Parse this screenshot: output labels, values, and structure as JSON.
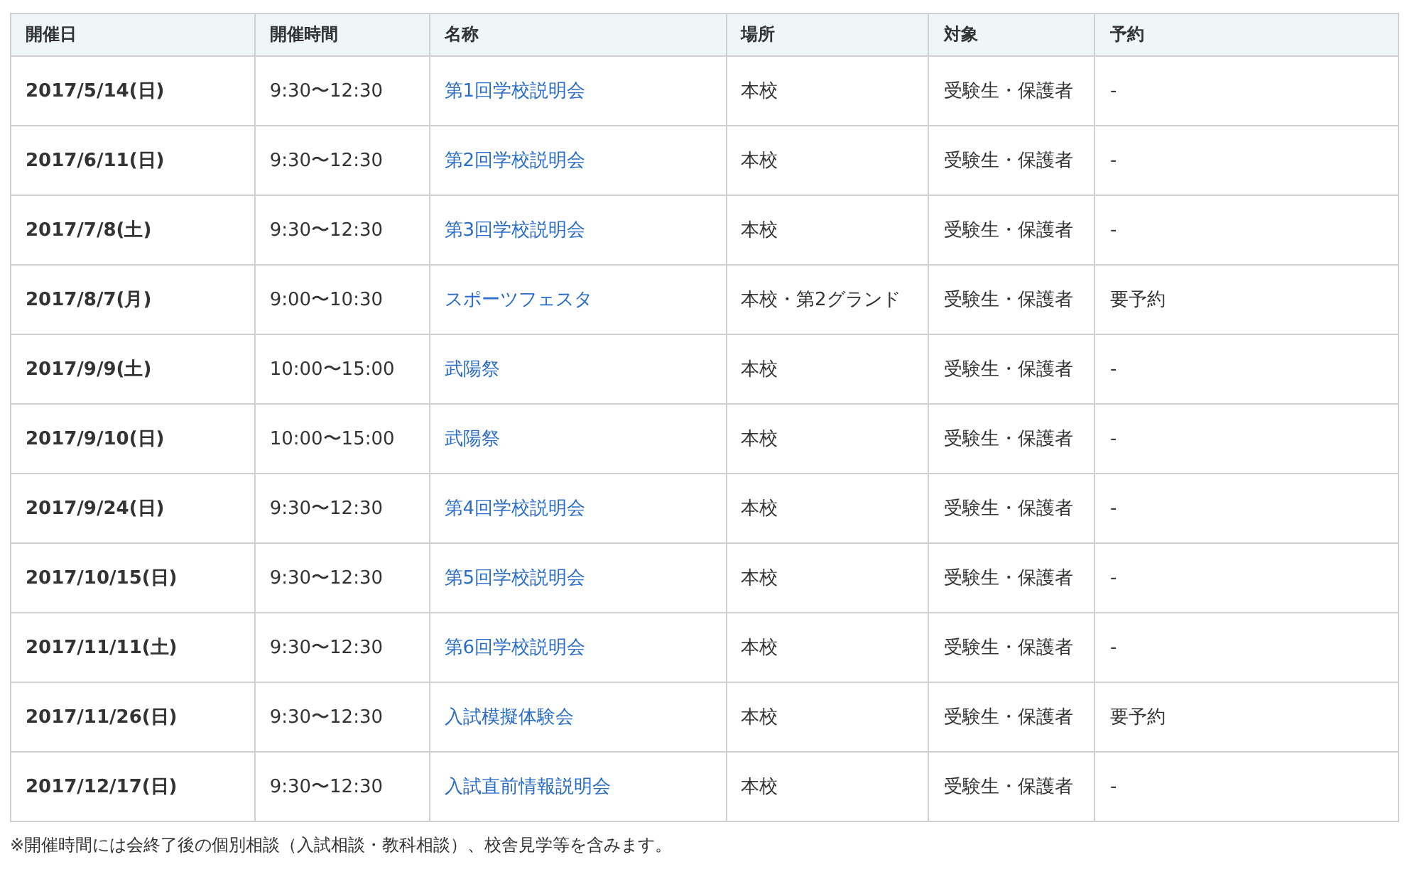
{
  "table": {
    "columns": [
      "開催日",
      "開催時間",
      "名称",
      "場所",
      "対象",
      "予約"
    ],
    "rows": [
      [
        "2017/5/14(日)",
        "9:30〜12:30",
        "第1回学校説明会",
        "本校",
        "受験生・保護者",
        "-"
      ],
      [
        "2017/6/11(日)",
        "9:30〜12:30",
        "第2回学校説明会",
        "本校",
        "受験生・保護者",
        "-"
      ],
      [
        "2017/7/8(土)",
        "9:30〜12:30",
        "第3回学校説明会",
        "本校",
        "受験生・保護者",
        "-"
      ],
      [
        "2017/8/7(月)",
        "9:00〜10:30",
        "スポーツフェスタ",
        "本校・第2グランド",
        "受験生・保護者",
        "要予約"
      ],
      [
        "2017/9/9(土)",
        "10:00〜15:00",
        "武陽祭",
        "本校",
        "受験生・保護者",
        "-"
      ],
      [
        "2017/9/10(日)",
        "10:00〜15:00",
        "武陽祭",
        "本校",
        "受験生・保護者",
        "-"
      ],
      [
        "2017/9/24(日)",
        "9:30〜12:30",
        "第4回学校説明会",
        "本校",
        "受験生・保護者",
        "-"
      ],
      [
        "2017/10/15(日)",
        "9:30〜12:30",
        "第5回学校説明会",
        "本校",
        "受験生・保護者",
        "-"
      ],
      [
        "2017/11/11(土)",
        "9:30〜12:30",
        "第6回学校説明会",
        "本校",
        "受験生・保護者",
        "-"
      ],
      [
        "2017/11/26(日)",
        "9:30〜12:30",
        "入試模擬体験会",
        "本校",
        "受験生・保護者",
        "要予約"
      ],
      [
        "2017/12/17(日)",
        "9:30〜12:30",
        "入試直前情報説明会",
        "本校",
        "受験生・保護者",
        "-"
      ]
    ]
  },
  "footnote": "※開催時間には会終了後の個別相談（入試相談・教科相談）、校舎見学等を含みます。"
}
